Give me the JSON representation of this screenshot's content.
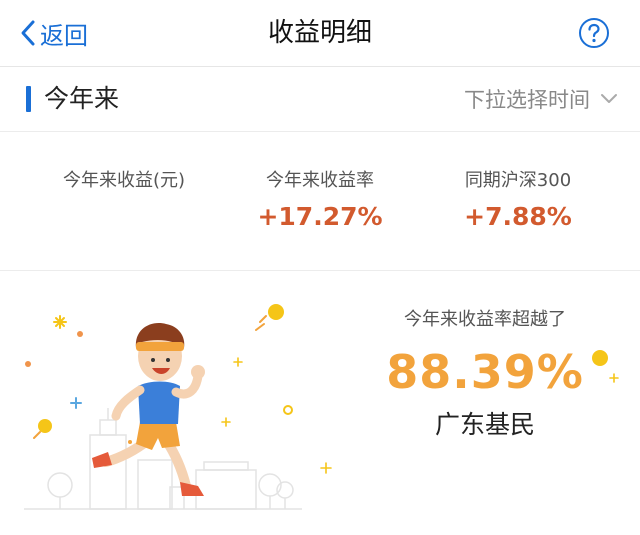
{
  "navbar": {
    "back_label": "返回",
    "title": "收益明细",
    "help_icon": "question-circle-icon"
  },
  "section": {
    "title": "今年来",
    "picker_label": "下拉选择时间",
    "picker_icon": "chevron-down-icon"
  },
  "stats": {
    "ytd_income_label": "今年来收益(元)",
    "ytd_return_label": "今年来收益率",
    "ytd_return_value": "+17.27%",
    "benchmark_label": "同期沪深300",
    "benchmark_value": "+7.88%"
  },
  "ranking": {
    "label": "今年来收益率超越了",
    "value": "88.39%",
    "sub": "广东基民"
  },
  "colors": {
    "accent_blue": "#1a6fd6",
    "positive_red": "#d25a2e",
    "highlight_orange": "#f2a33c",
    "runner_shirt": "#3b7fd9",
    "runner_shorts": "#f2a33c",
    "coin": "#f5c518"
  }
}
